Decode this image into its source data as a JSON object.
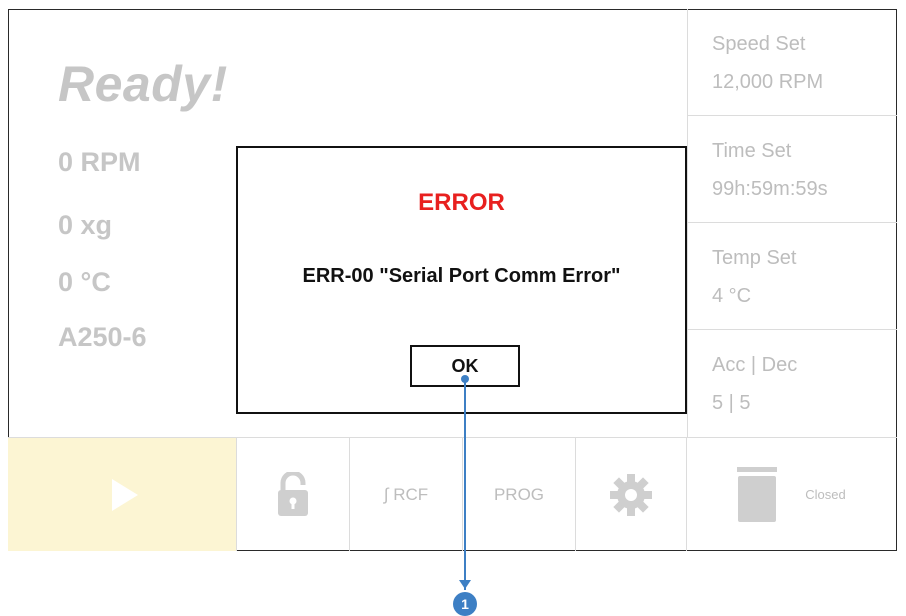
{
  "status": {
    "title": "Ready!"
  },
  "readouts": {
    "rpm": "0 RPM",
    "rcf": "0 xg",
    "temp": "0 °C",
    "rotor": "A250-6"
  },
  "settings": [
    {
      "label": "Speed Set",
      "value": "12,000 RPM"
    },
    {
      "label": "Time Set",
      "value": "99h:59m:59s"
    },
    {
      "label": "Temp Set",
      "value": "4 °C"
    },
    {
      "label": "Acc | Dec",
      "value": "5 | 5"
    }
  ],
  "bottom_bar": {
    "rcf_label": "∫ RCF",
    "prog_label": "PROG",
    "lid_status": "Closed"
  },
  "dialog": {
    "title": "ERROR",
    "message": "ERR-00 \"Serial Port Comm Error\"",
    "ok_label": "OK"
  },
  "callout": {
    "number": "1"
  },
  "colors": {
    "error": "#e8201f",
    "accent": "#3d7fc4",
    "play_bg": "#fcf5d3",
    "muted": "#c6c6c6"
  },
  "icons": [
    "play-icon",
    "unlock-icon",
    "gear-icon",
    "lid-icon"
  ]
}
